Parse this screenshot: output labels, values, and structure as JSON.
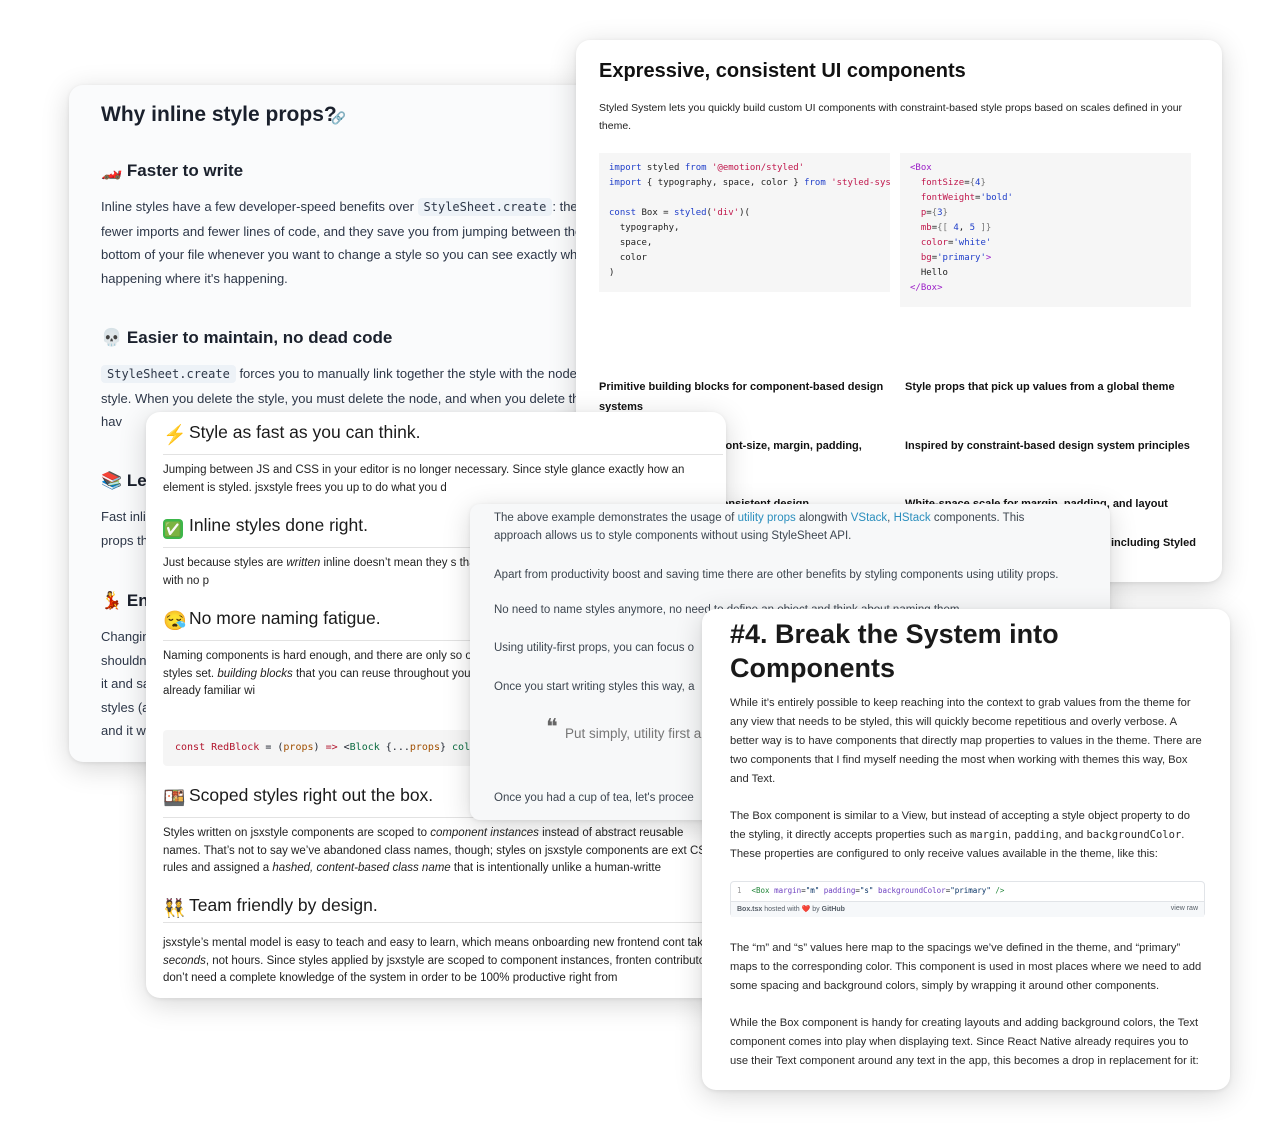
{
  "card_inline": {
    "title": "Why inline style props?",
    "link_icon": "🔗",
    "sections": [
      {
        "emoji": "🏎️",
        "heading": "Faster to write"
      },
      {
        "emoji": "💀",
        "heading": "Easier to maintain, no dead code"
      },
      {
        "emoji": "📚",
        "heading": "Les"
      },
      {
        "emoji": "💃",
        "heading": "Enc"
      }
    ],
    "p1_pre": "Inline styles have a few developer-speed benefits over ",
    "p1_code": "StyleSheet.create",
    "p1_post": ": they require fewer imports and fewer lines of code, and they save you from jumping between the top and bottom of your file whenever you want to change a style so you can see exactly what's happening where it's happening.",
    "p2_code": "StyleSheet.create",
    "p2_post": " forces you to manually link together the style with the node that uses the style. When you delete the style, you must delete the node, and when you delete the node, you hav",
    "p3": "Fast inli props th",
    "p4": "Changin shouldn it and sa styles (a and it w"
  },
  "card_styled": {
    "title": "Expressive, consistent UI components",
    "intro": "Styled System lets you quickly build custom UI components with constraint-based style props based on scales defined in your theme.",
    "features": [
      "Primitive building blocks for component-based design systems",
      "Style props that pick up values from a global theme",
      "Quickly set responsive font-size, margin, padding, width, and more",
      "Inspired by constraint-based design system principles",
      "Typographic scale for consistent design",
      "White-space scale for margin, padding, and layout",
      "including Styled"
    ]
  },
  "card_jsx": {
    "sections": [
      {
        "emoji": "⚡",
        "heading": "Style as fast as you can think.",
        "text": "Jumping between JS and CSS in your editor is no longer necessary. Since style glance exactly how an element is styled. jsxstyle frees you up to do what you d"
      },
      {
        "emoji": "✅",
        "heading": "Inline styles done right.",
        "text_pre": "Just because styles are ",
        "text_em": "written",
        "text_post": " inline doesn’t mean they s that a best-in-class developer experience comes with no p"
      },
      {
        "emoji": "😪",
        "heading": "No more naming fatigue.",
        "text_pre": "Naming components is hard enough, and there are only so of stylable components, each with a few default styles set. ",
        "text_em": "building blocks",
        "text_post": " that you can reuse throughout your applica you wish, by utilizing a paradigm you’re already familiar wi"
      },
      {
        "emoji": "🍱",
        "heading": "Scoped styles right out the box.",
        "text_pre": "Styles written on jsxstyle components are scoped to ",
        "text_em": "component instances",
        "text_mid": " instead of abstract reusable names. That’s not to say we’ve abandoned class names, though; styles on jsxstyle components are ext CSS rules and assigned a ",
        "text_em2": "hashed, content-based class name",
        "text_post": " that is intentionally unlike a human-writte"
      },
      {
        "emoji": "👯",
        "heading": "Team friendly by design.",
        "text_pre": "jsxstyle’s mental model is easy to teach and easy to learn, which means onboarding new frontend cont takes ",
        "text_em": "seconds",
        "text_post": ", not hours. Since styles applied by jsxstyle are scoped to component instances, fronten contributors don’t need a complete knowledge of the system in order to be 100% productive right from"
      }
    ]
  },
  "card_utility": {
    "p1_pre": "The above example demonstrates the usage of ",
    "link1": "utility props",
    "p1_mid": " alongwith ",
    "link2": "VStack",
    "link3": "HStack",
    "p1_post": " components. This approach allows us to style components without using StyleSheet API.",
    "p2": "Apart from productivity boost and saving time there are other benefits by styling components using utility props.",
    "p3": "No need to name styles anymore, no need to define an object and think about naming them.",
    "p4": "Using utility-first props, you can focus o",
    "p5": "Once you start writing styles this way, a",
    "quote": "Put simply, utility first a",
    "p6": "Once you had a cup of tea, let's procee"
  },
  "card_system": {
    "title": "#4. Break the System into Components",
    "p1": "While it’s entirely possible to keep reaching into the context to grab values from the theme for any view that needs to be styled, this will quickly become repetitious and overly verbose. A better way is to have components that directly map properties to values in the theme. There are two components that I find myself needing the most when working with themes this way, Box and Text.",
    "p2_pre": "The Box component is similar to a View, but instead of accepting a style object property to do the styling, it directly accepts properties such as ",
    "p2_c1": "margin",
    "p2_c2": "padding",
    "p2_c3": "backgroundColor",
    "p2_post": ". These properties are configured to only receive values available in the theme, like this:",
    "gist_line_no": "1",
    "gist_file": "Box.tsx",
    "gist_hosted": " hosted with ",
    "gist_heart": "❤️",
    "gist_by": " by ",
    "gist_github": "GitHub",
    "gist_raw": "view raw",
    "p3": "The “m” and “s” values here map to the spacings we’ve defined in the theme, and “primary” maps to the corresponding color. This component is used in most places where we need to add some spacing and background colors, simply by wrapping it around other components.",
    "p4": "While the Box component is handy for creating layouts and adding background colors, the Text component comes into play when displaying text. Since React Native already requires you to use their Text component around any text in the app, this becomes a drop in replacement for it:"
  }
}
